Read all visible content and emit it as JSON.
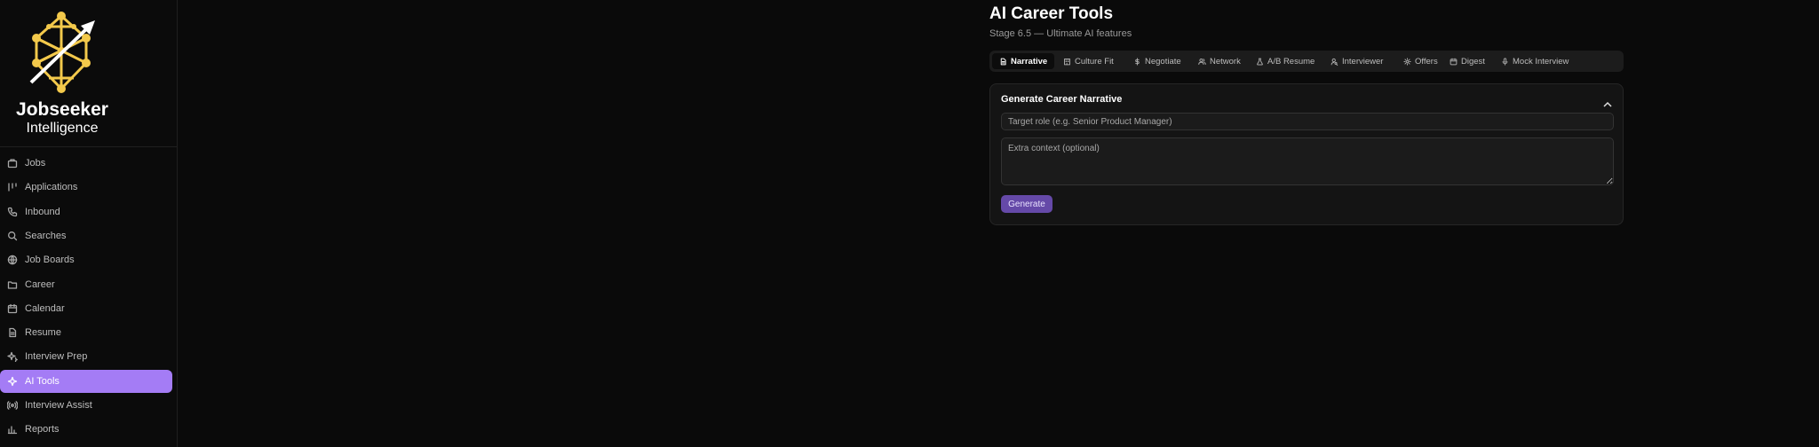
{
  "brand": {
    "name": "Jobseeker",
    "subtitle": "Intelligence",
    "logo_icon": "network-arrow-logo"
  },
  "nav": {
    "active_index": 9,
    "items": [
      {
        "label": "Jobs",
        "icon": "briefcase-icon"
      },
      {
        "label": "Applications",
        "icon": "kanban-icon"
      },
      {
        "label": "Inbound",
        "icon": "phone-icon"
      },
      {
        "label": "Searches",
        "icon": "search-icon"
      },
      {
        "label": "Job Boards",
        "icon": "globe-icon"
      },
      {
        "label": "Career",
        "icon": "folder-icon"
      },
      {
        "label": "Calendar",
        "icon": "calendar-icon"
      },
      {
        "label": "Resume",
        "icon": "document-icon"
      },
      {
        "label": "Interview Prep",
        "icon": "sparkles-icon"
      },
      {
        "label": "AI Tools",
        "icon": "sparkle-icon"
      },
      {
        "label": "Interview Assist",
        "icon": "radio-icon"
      },
      {
        "label": "Reports",
        "icon": "bar-chart-icon"
      }
    ]
  },
  "page": {
    "title": "AI Career Tools",
    "subtitle": "Stage 6.5 — Ultimate AI features"
  },
  "tabs": [
    {
      "label": "Narrative",
      "icon": "document-icon",
      "active": true
    },
    {
      "label": "Culture Fit",
      "icon": "building-icon"
    },
    {
      "label": "Negotiate",
      "icon": "dollar-icon"
    },
    {
      "label": "Network",
      "icon": "users-icon"
    },
    {
      "label": "A/B Resume",
      "icon": "flask-icon"
    },
    {
      "label": "Interviewer",
      "icon": "user-search-icon"
    },
    {
      "label": "Offers",
      "icon": "gear-icon"
    },
    {
      "label": "Digest",
      "icon": "calendar-icon"
    },
    {
      "label": "Mock Interview",
      "icon": "microphone-icon"
    }
  ],
  "card": {
    "title": "Generate Career Narrative",
    "collapse_icon": "chevron-up-icon",
    "role_placeholder": "Target role (e.g. Senior Product Manager)",
    "context_placeholder": "Extra context (optional)",
    "generate_label": "Generate"
  },
  "colors": {
    "accent": "#a47cf5",
    "button": "#6549a8",
    "logo": "#f3c94b",
    "background": "#0a0a0a"
  }
}
